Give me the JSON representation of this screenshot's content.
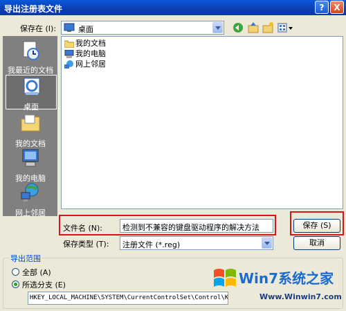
{
  "window": {
    "title": "导出注册表文件",
    "help_glyph": "?",
    "close_glyph": "X"
  },
  "savein": {
    "label": "保存在 (I):",
    "value": "桌面"
  },
  "places": [
    {
      "label": "我最近的文档",
      "icon": "recent-docs-icon"
    },
    {
      "label": "桌面",
      "icon": "desktop-icon",
      "selected": true
    },
    {
      "label": "我的文档",
      "icon": "my-documents-icon"
    },
    {
      "label": "我的电脑",
      "icon": "my-computer-icon"
    },
    {
      "label": "网上邻居",
      "icon": "network-places-icon"
    }
  ],
  "files": [
    {
      "label": "我的文档",
      "icon": "folder-icon"
    },
    {
      "label": "我的电脑",
      "icon": "computer-icon"
    },
    {
      "label": "网上邻居",
      "icon": "network-icon"
    }
  ],
  "filename": {
    "label": "文件名 (N):",
    "value": "检测到不兼容的键盘驱动程序的解决方法"
  },
  "filetype": {
    "label": "保存类型 (T):",
    "value": "注册文件 (*.reg)"
  },
  "buttons": {
    "save": "保存 (S)",
    "cancel": "取消"
  },
  "export_range": {
    "title": "导出范围",
    "all_label": "全部 (A)",
    "branch_label": "所选分支 (E)",
    "selected": "branch",
    "branch_value": "HKEY_LOCAL_MACHINE\\SYSTEM\\CurrentControlSet\\Control\\Keyboard Layouts"
  },
  "watermark": {
    "logo_text": "Win7系统之家",
    "url": "Www.Winwin7.com"
  },
  "colors": {
    "titlebar": "#0b3fb0",
    "highlight": "#d8141a",
    "places_bg": "#808080"
  }
}
